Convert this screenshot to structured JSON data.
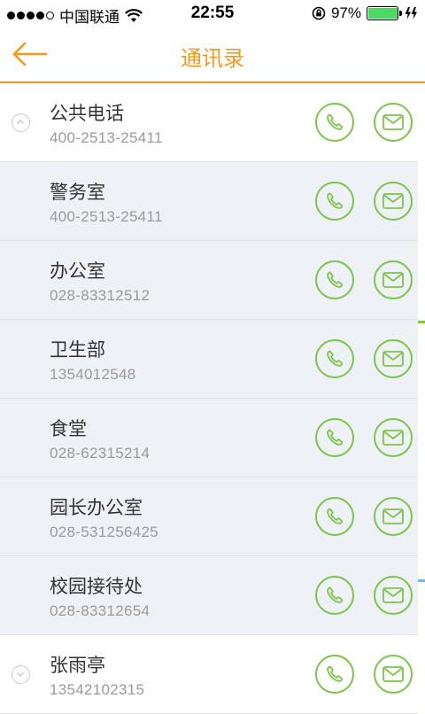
{
  "status_bar": {
    "carrier": "中国联通",
    "time": "22:55",
    "battery_percent": "97%",
    "battery_level": 0.97,
    "icons": [
      "signal-dots-icon",
      "wifi-icon",
      "rotation-lock-icon",
      "battery-icon",
      "charging-icon"
    ]
  },
  "nav": {
    "title": "通讯录",
    "back_icon": "back-arrow-icon"
  },
  "contacts": [
    {
      "name": "公共电话",
      "phone": "400-2513-25411",
      "type": "group",
      "expanded": true
    },
    {
      "name": "警务室",
      "phone": "400-2513-25411",
      "type": "child"
    },
    {
      "name": "办公室",
      "phone": "028-83312512",
      "type": "child"
    },
    {
      "name": "卫生部",
      "phone": "1354012548",
      "type": "child"
    },
    {
      "name": "食堂",
      "phone": "028-62315214",
      "type": "child"
    },
    {
      "name": "园长办公室",
      "phone": "028-531256425",
      "type": "child"
    },
    {
      "name": "校园接待处",
      "phone": "028-83312654",
      "type": "child"
    },
    {
      "name": "张雨亭",
      "phone": "13542102315",
      "type": "group",
      "expanded": false
    }
  ],
  "actions": {
    "call_icon": "phone-icon",
    "message_icon": "envelope-icon"
  },
  "colors": {
    "accent": "#f39a1e",
    "action_green": "#7cc44a",
    "child_row_bg": "#eef1f6",
    "secondary_text": "#9a9a9a"
  }
}
